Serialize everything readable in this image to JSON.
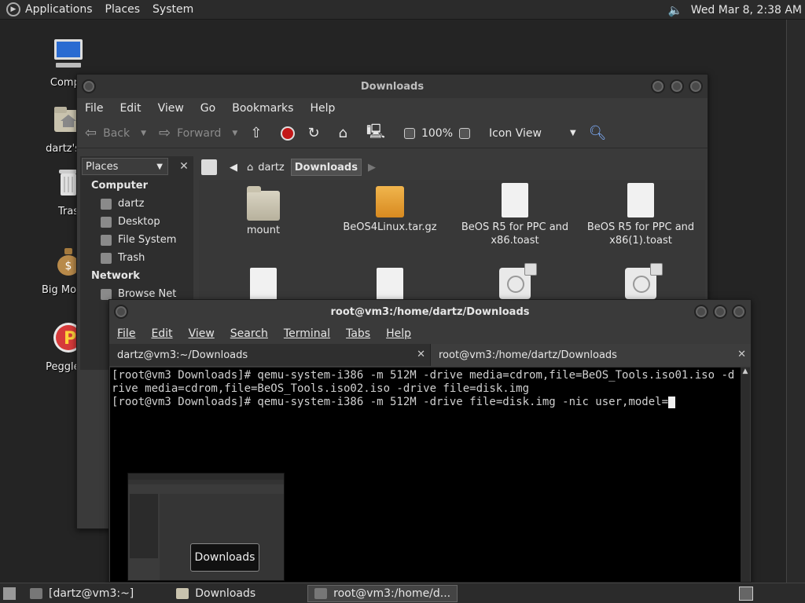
{
  "top_panel": {
    "menus": [
      "Applications",
      "Places",
      "System"
    ],
    "clock": "Wed Mar  8,  2:38 AM"
  },
  "desktop": {
    "icons": [
      {
        "label": "Compu",
        "icon": "computer-icon"
      },
      {
        "label": "dartz's H",
        "icon": "home-folder-icon"
      },
      {
        "label": "Tras",
        "icon": "trash-icon"
      },
      {
        "label": "Big Money",
        "icon": "money-bag-icon"
      },
      {
        "label": "Peggle D",
        "icon": "peggle-icon"
      }
    ]
  },
  "file_manager": {
    "title": "Downloads",
    "menus": [
      "File",
      "Edit",
      "View",
      "Go",
      "Bookmarks",
      "Help"
    ],
    "toolbar": {
      "back": "Back",
      "forward": "Forward",
      "zoom": "100%",
      "view_mode": "Icon View"
    },
    "sidebar": {
      "combo": "Places",
      "sections": [
        {
          "title": "Computer",
          "items": [
            "dartz",
            "Desktop",
            "File System",
            "Trash"
          ]
        },
        {
          "title": "Network",
          "items": [
            "Browse Net"
          ]
        }
      ]
    },
    "pathbar": [
      "dartz",
      "Downloads"
    ],
    "files": [
      {
        "name": "mount",
        "type": "folder"
      },
      {
        "name": "BeOS4Linux.tar.gz",
        "type": "package"
      },
      {
        "name": "BeOS R5 for PPC and x86.toast",
        "type": "document"
      },
      {
        "name": "BeOS R5 for PPC and x86(1).toast",
        "type": "document"
      }
    ]
  },
  "terminal": {
    "title": "root@vm3:/home/dartz/Downloads",
    "menus": [
      "File",
      "Edit",
      "View",
      "Search",
      "Terminal",
      "Tabs",
      "Help"
    ],
    "tabs": [
      "dartz@vm3:~/Downloads",
      "root@vm3:/home/dartz/Downloads"
    ],
    "lines": [
      "[root@vm3 Downloads]# qemu-system-i386 -m 512M -drive media=cdrom,file=BeOS_Tools.iso01.iso -drive media=cdrom,file=BeOS_Tools.iso02.iso -drive file=disk.img",
      "[root@vm3 Downloads]# qemu-system-i386 -m 512M -drive file=disk.img -nic user,model="
    ]
  },
  "switcher": {
    "label": "Downloads"
  },
  "bottom_panel": {
    "tasks": [
      "[dartz@vm3:~]",
      "Downloads",
      "root@vm3:/home/d..."
    ]
  }
}
